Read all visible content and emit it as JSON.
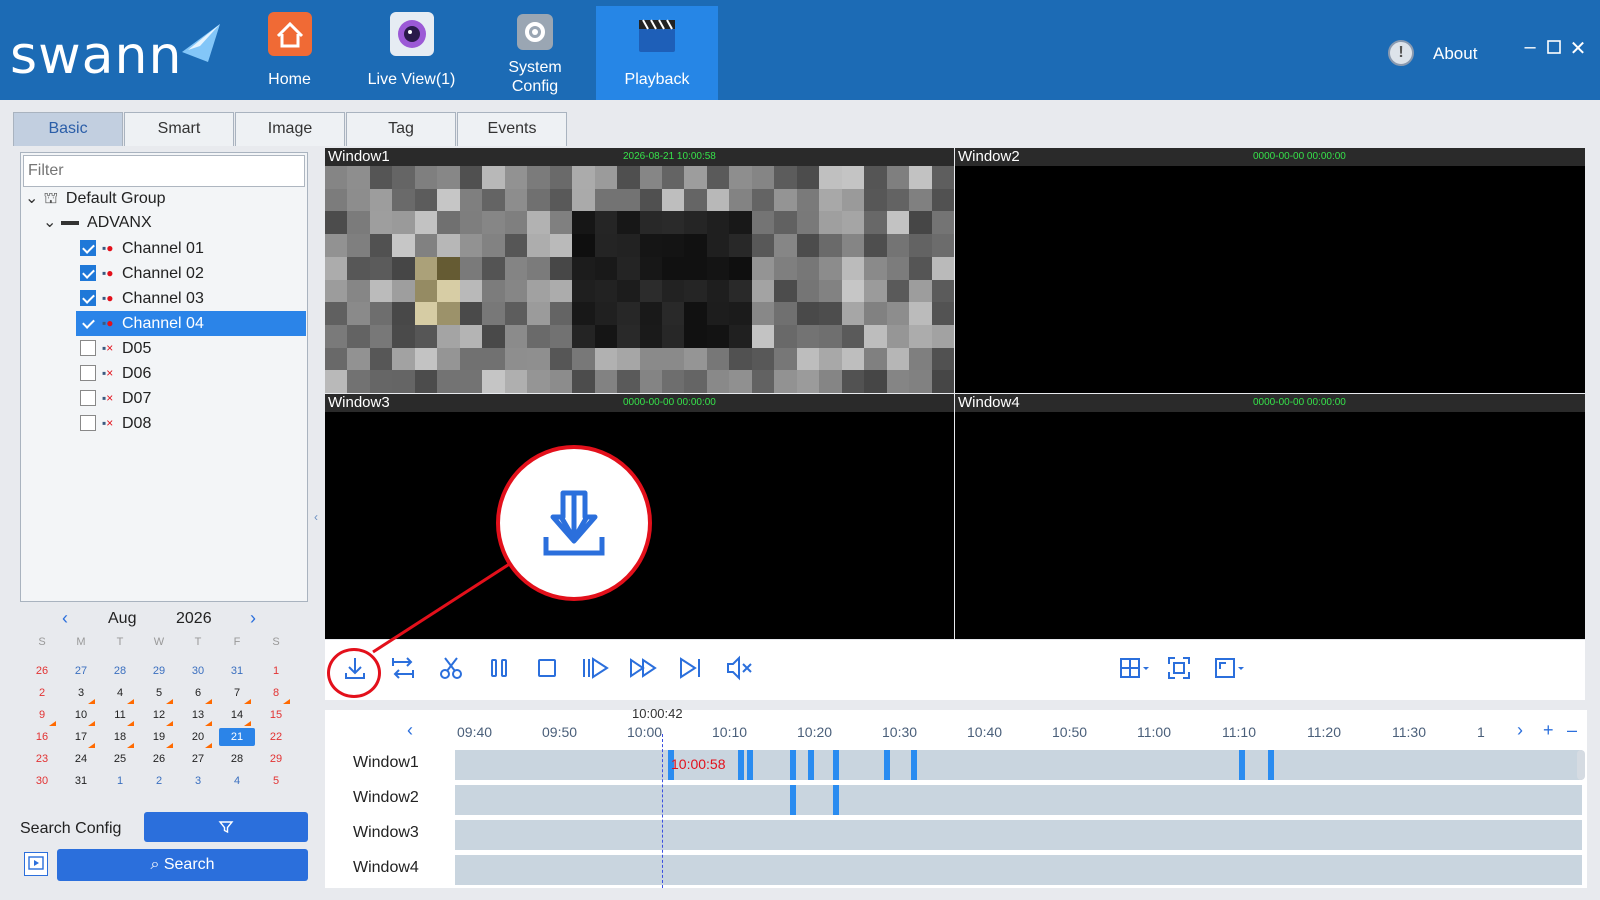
{
  "app": {
    "brand": "swann",
    "colors": {
      "header": "#1c6bb5",
      "active_nav": "#2686e6",
      "accent": "#2b6fdc",
      "record_segment": "#2a8cf0",
      "highlight": "#e3101b"
    }
  },
  "nav": {
    "items": [
      {
        "label": "Home",
        "icon": "home-icon"
      },
      {
        "label": "Live View(1)",
        "icon": "camera-icon"
      },
      {
        "label": "System Config",
        "icon": "settings-icon"
      },
      {
        "label": "Playback",
        "icon": "clapperboard-icon",
        "active": true
      }
    ],
    "about": "About"
  },
  "tabs": [
    "Basic",
    "Smart",
    "Image",
    "Tag",
    "Events"
  ],
  "tree": {
    "filter_placeholder": "Filter",
    "group": "Default Group",
    "device": "ADVANX",
    "channels": [
      {
        "label": "Channel 01",
        "checked": true,
        "online": true
      },
      {
        "label": "Channel 02",
        "checked": true,
        "online": true
      },
      {
        "label": "Channel 03",
        "checked": true,
        "online": true
      },
      {
        "label": "Channel 04",
        "checked": true,
        "online": true,
        "selected": true
      },
      {
        "label": "D05",
        "checked": false,
        "online": false
      },
      {
        "label": "D06",
        "checked": false,
        "online": false
      },
      {
        "label": "D07",
        "checked": false,
        "online": false
      },
      {
        "label": "D08",
        "checked": false,
        "online": false
      }
    ]
  },
  "calendar": {
    "month": "Aug",
    "year": "2026",
    "weekdays": [
      "S",
      "M",
      "T",
      "W",
      "T",
      "F",
      "S"
    ],
    "weeks": [
      [
        "26",
        "27",
        "28",
        "29",
        "30",
        "31",
        "1"
      ],
      [
        "2",
        "3",
        "4",
        "5",
        "6",
        "7",
        "8"
      ],
      [
        "9",
        "10",
        "11",
        "12",
        "13",
        "14",
        "15"
      ],
      [
        "16",
        "17",
        "18",
        "19",
        "20",
        "21",
        "22"
      ],
      [
        "23",
        "24",
        "25",
        "26",
        "27",
        "28",
        "29"
      ],
      [
        "30",
        "31",
        "1",
        "2",
        "3",
        "4",
        "5"
      ]
    ],
    "selected_day": "21"
  },
  "search": {
    "config_label": "Search Config",
    "button": "Search"
  },
  "windows": [
    {
      "title": "Window1",
      "time": "2026-08-21 10:00:58"
    },
    {
      "title": "Window2",
      "time": "0000-00-00 00:00:00"
    },
    {
      "title": "Window3",
      "time": "0000-00-00 00:00:00"
    },
    {
      "title": "Window4",
      "time": "0000-00-00 00:00:00"
    }
  ],
  "timeline": {
    "cursor_time": "10:00:42",
    "cursor_label": "10:00:58",
    "ticks": [
      "09:40",
      "09:50",
      "10:00",
      "10:10",
      "10:20",
      "10:30",
      "10:40",
      "10:50",
      "11:00",
      "11:10",
      "11:20",
      "11:30",
      "1"
    ],
    "rows": [
      "Window1",
      "Window2",
      "Window3",
      "Window4"
    ]
  }
}
